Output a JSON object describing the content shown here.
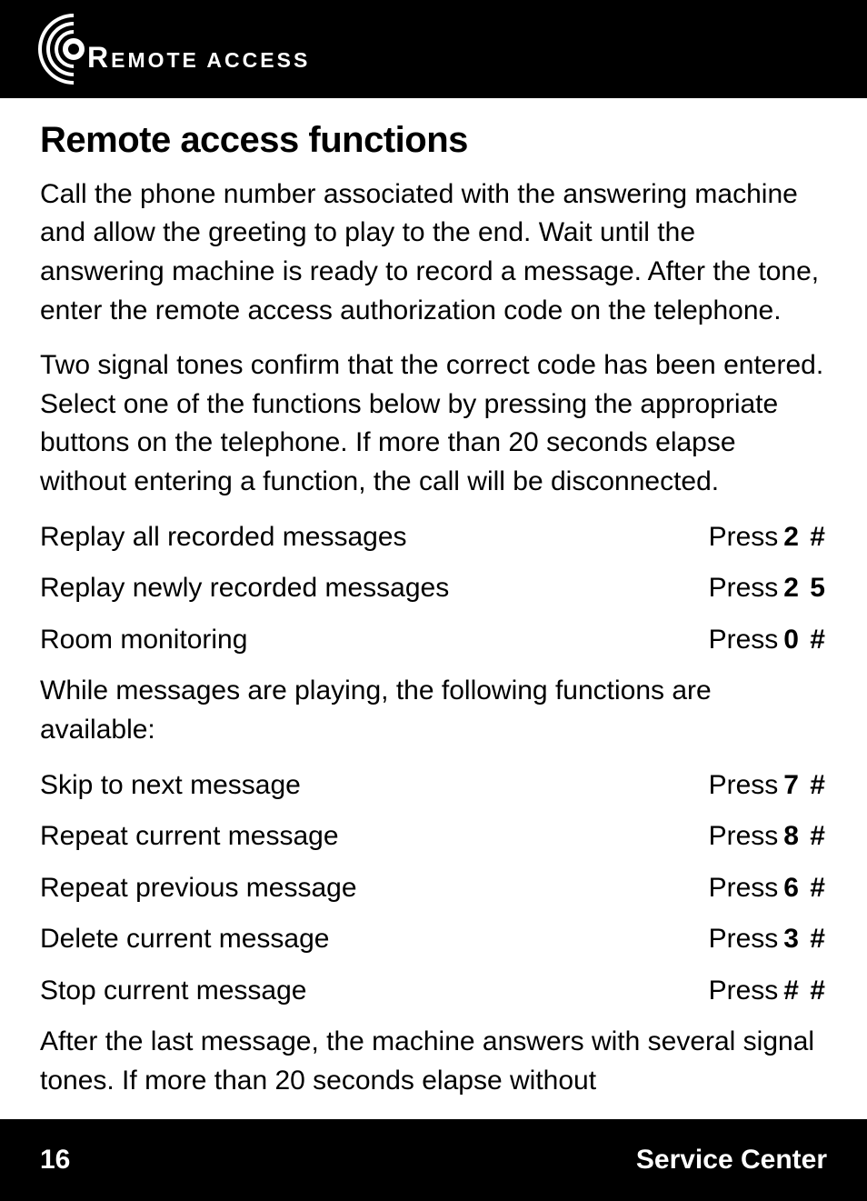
{
  "header": {
    "label_prefix": "R",
    "label_rest": "EMOTE ACCESS"
  },
  "content": {
    "title": "Remote access functions",
    "para1": "Call the phone number associated with the answering machine and allow the greeting to play to the end. Wait until the answering machine is ready to record a message. After the tone, enter the remote access authorization code on the telephone.",
    "para2": "Two signal tones confirm that the correct code has been entered. Select one of the functions below by pressing the appropriate buttons on the telephone. If more than 20 seconds elapse without entering a function, the call will be disconnected.",
    "press_word": "Press",
    "group1": [
      {
        "label": "Replay all recorded messages",
        "key": "2 #"
      },
      {
        "label": "Replay newly recorded messages",
        "key": "2 5"
      },
      {
        "label": "Room monitoring",
        "key": "0 #"
      }
    ],
    "para3": "While messages are playing, the following functions are available:",
    "group2": [
      {
        "label": "Skip to next message",
        "key": "7 #"
      },
      {
        "label": "Repeat current message",
        "key": "8 #"
      },
      {
        "label": "Repeat previous message",
        "key": "6 #"
      },
      {
        "label": "Delete current message",
        "key": "3 #"
      },
      {
        "label": "Stop current message",
        "key": "# #"
      }
    ],
    "para4": "After the last message, the machine answers with several signal tones. If more than 20 seconds elapse without"
  },
  "footer": {
    "page_number": "16",
    "service_label": "Service Center"
  }
}
